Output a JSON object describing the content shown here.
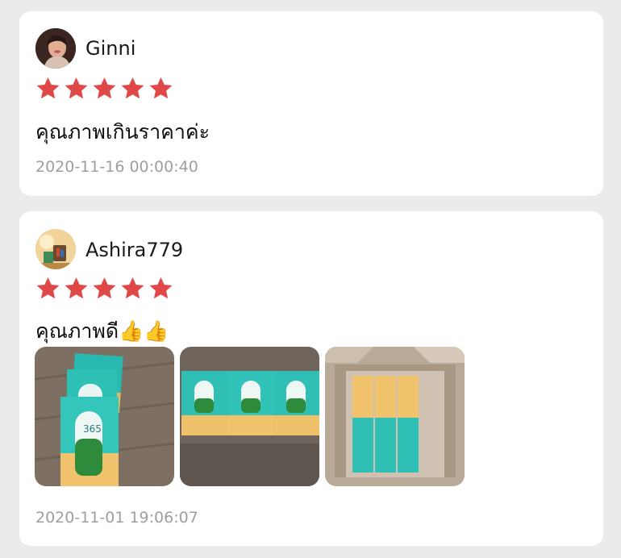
{
  "reviews": [
    {
      "username": "Ginni",
      "rating": 5,
      "comment": "คุณภาพเกินราคาค่ะ",
      "timestamp": "2020-11-16 00:00:40"
    },
    {
      "username": "Ashira779",
      "rating": 5,
      "comment": "คุณภาพดี👍👍",
      "timestamp": "2020-11-01 19:06:07",
      "photo_count": 3
    }
  ],
  "colors": {
    "star": "#e04848",
    "timestamp": "#9e9e9e",
    "card": "#ffffff",
    "background": "#ebebeb"
  },
  "icons": {
    "rating_star": "star-icon"
  }
}
